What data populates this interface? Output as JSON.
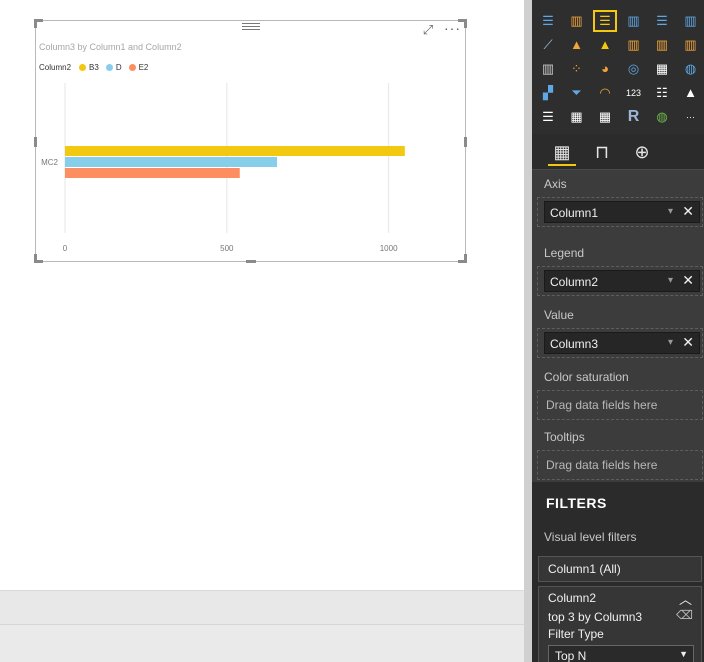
{
  "chart_visual": {
    "title": "Column3 by Column1 and Column2",
    "legend_title": "Column2",
    "legend": [
      {
        "name": "B3",
        "color": "#F2C811"
      },
      {
        "name": "D",
        "color": "#87CEEB"
      },
      {
        "name": "E2",
        "color": "#FD8E62"
      }
    ]
  },
  "chart_data": {
    "type": "bar",
    "orientation": "horizontal",
    "categories": [
      "MC2"
    ],
    "series": [
      {
        "name": "B3",
        "values": [
          1050
        ],
        "color": "#F2C811"
      },
      {
        "name": "D",
        "values": [
          655
        ],
        "color": "#87CEEB"
      },
      {
        "name": "E2",
        "values": [
          540
        ],
        "color": "#FD8E62"
      }
    ],
    "xlim": [
      0,
      1150
    ],
    "x_ticks": [
      0,
      500,
      1000
    ],
    "x_tick_labels": [
      "0",
      "500",
      "1000"
    ],
    "gridlines": true,
    "legend_position": "top-left"
  },
  "viz_gallery": {
    "icons": [
      "stacked-bar-chart-icon",
      "stacked-column-chart-icon",
      "clustered-bar-chart-icon",
      "clustered-column-chart-icon",
      "100-stacked-bar-chart-icon",
      "100-stacked-column-chart-icon",
      "line-chart-icon",
      "area-chart-icon",
      "stacked-area-chart-icon",
      "line-and-stacked-column-chart-icon",
      "line-and-clustered-column-chart-icon",
      "ribbon-chart-icon",
      "waterfall-chart-icon",
      "scatter-chart-icon",
      "pie-chart-icon",
      "donut-chart-icon",
      "treemap-icon",
      "map-icon",
      "filled-map-icon",
      "funnel-icon",
      "gauge-icon",
      "card-icon",
      "multi-row-card-icon",
      "kpi-icon",
      "slicer-icon",
      "table-icon",
      "matrix-icon",
      "r-visual-icon",
      "globe-icon",
      "more-visuals-icon"
    ],
    "selected": "clustered-bar-chart-icon"
  },
  "pane_tabs": [
    "fields-tab-icon",
    "format-paint-roller-icon",
    "analytics-magnifier-icon"
  ],
  "wells": {
    "axis": {
      "label": "Axis",
      "field": "Column1"
    },
    "legend": {
      "label": "Legend",
      "field": "Column2"
    },
    "value": {
      "label": "Value",
      "field": "Column3"
    },
    "color_saturation": {
      "label": "Color saturation",
      "placeholder": "Drag data fields here"
    },
    "tooltips": {
      "label": "Tooltips",
      "placeholder": "Drag data fields here"
    }
  },
  "filters": {
    "title": "FILTERS",
    "visual_level_label": "Visual level filters",
    "column1_card": "Column1  (All)",
    "column2_card": {
      "name": "Column2",
      "summary": "top 3 by Column3",
      "filter_type_label": "Filter Type",
      "filter_type_value": "Top N"
    }
  },
  "glyphs": {
    "focus": "⤢",
    "more": "···",
    "remove": "✕",
    "chevron_down": "▾",
    "collapse": "︿",
    "eraser": "⌫",
    "select_chevron": "▼"
  }
}
